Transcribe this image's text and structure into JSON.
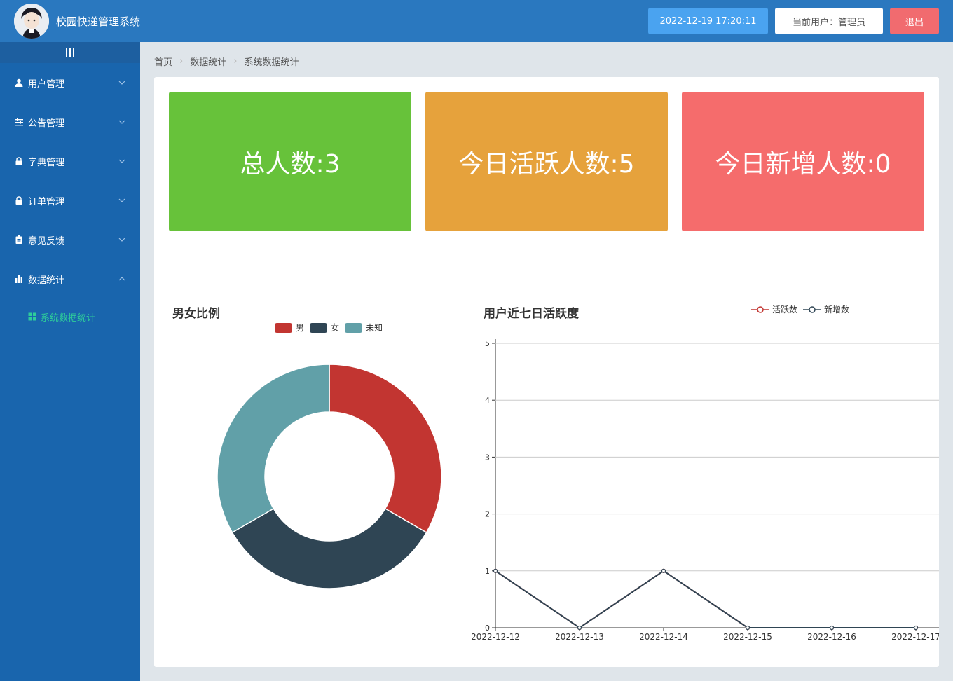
{
  "header": {
    "app_title": "校园快递管理系统",
    "datetime": "2022-12-19 17:20:11",
    "current_user": "当前用户：管理员",
    "logout_label": "退出"
  },
  "sidebar": {
    "items": [
      {
        "label": "用户管理",
        "icon": "user-icon"
      },
      {
        "label": "公告管理",
        "icon": "sliders-icon"
      },
      {
        "label": "字典管理",
        "icon": "lock-icon"
      },
      {
        "label": "订单管理",
        "icon": "lock-icon"
      },
      {
        "label": "意见反馈",
        "icon": "clipboard-icon"
      },
      {
        "label": "数据统计",
        "icon": "bar-chart-icon"
      }
    ],
    "sub_item": {
      "label": "系统数据统计",
      "icon": "grid-icon"
    }
  },
  "breadcrumb": [
    "首页",
    "数据统计",
    "系统数据统计"
  ],
  "stats": [
    {
      "label": "总人数:3",
      "color": "#67c23a"
    },
    {
      "label": "今日活跃人数:5",
      "color": "#e6a23c"
    },
    {
      "label": "今日新增人数:0",
      "color": "#f56c6c"
    }
  ],
  "chart_data": [
    {
      "type": "pie",
      "title": "男女比例",
      "categories": [
        "男",
        "女",
        "未知"
      ],
      "values": [
        1,
        1,
        1
      ],
      "colors": [
        "#c23531",
        "#2f4554",
        "#61a0a8"
      ],
      "legend_position": "top"
    },
    {
      "type": "line",
      "title": "用户近七日活跃度",
      "x": [
        "2022-12-12",
        "2022-12-13",
        "2022-12-14",
        "2022-12-15",
        "2022-12-16",
        "2022-12-17"
      ],
      "series": [
        {
          "name": "活跃数",
          "values": [
            1,
            0,
            1,
            0,
            0,
            0
          ],
          "color": "#c23531"
        },
        {
          "name": "新增数",
          "values": [
            1,
            0,
            1,
            0,
            0,
            0
          ],
          "color": "#2f4554"
        }
      ],
      "ylim": [
        0,
        5
      ],
      "yticks": [
        "0",
        "1",
        "2",
        "3",
        "4",
        "5"
      ],
      "grid": true,
      "legend_position": "top-right"
    }
  ]
}
